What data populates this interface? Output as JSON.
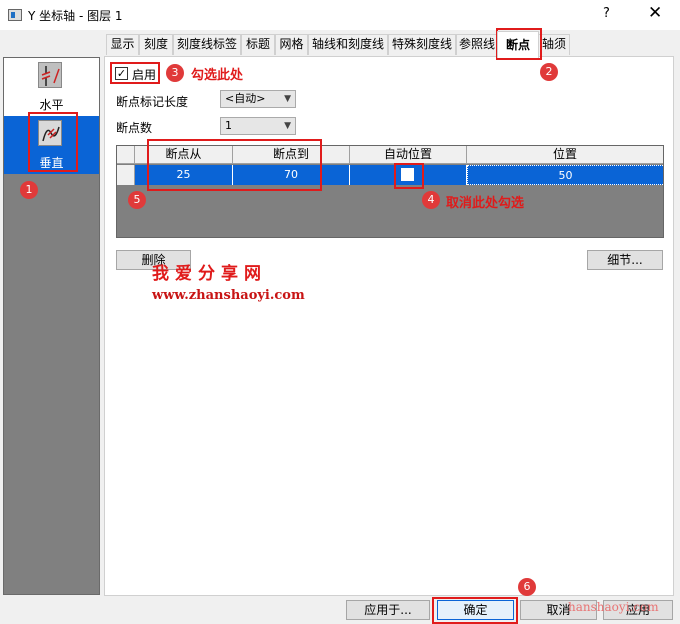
{
  "window": {
    "title": "Y 坐标轴 - 图层 1",
    "help": "?",
    "close": "✕"
  },
  "sidebar": {
    "items": [
      {
        "label": "水平",
        "icon": "horizontal-axis-break-icon",
        "selected": false
      },
      {
        "label": "垂直",
        "icon": "vertical-axis-break-icon",
        "selected": true
      }
    ]
  },
  "tabs": [
    "显示",
    "刻度",
    "刻度线标签",
    "标题",
    "网格",
    "轴线和刻度线",
    "特殊刻度线",
    "参照线",
    "断点",
    "轴须"
  ],
  "active_tab": "断点",
  "form": {
    "enable_label": "启用",
    "enable_checked": true,
    "mark_length_label": "断点标记长度",
    "mark_length_value": "<自动>",
    "count_label": "断点数",
    "count_value": "1"
  },
  "table": {
    "headers": [
      "断点从",
      "断点到",
      "自动位置",
      "位置"
    ],
    "rows": [
      {
        "from": "25",
        "to": "70",
        "auto_position": false,
        "position": "50"
      }
    ]
  },
  "buttons": {
    "delete": "删除",
    "details": "细节...",
    "apply_to": "应用于...",
    "ok": "确定",
    "cancel": "取消",
    "apply": "应用"
  },
  "annotations": {
    "badges": [
      "1",
      "2",
      "3",
      "4",
      "5",
      "6"
    ],
    "note3": "勾选此处",
    "note4": "取消此处勾选"
  },
  "watermark": {
    "title": "我爱分享网",
    "url": "www.zhanshaoyi.com",
    "url_overlay": "hanshaoyi.com"
  },
  "colors": {
    "selection": "#0a64d6",
    "annotation": "#e01b1b",
    "grid_bg": "#808080"
  }
}
